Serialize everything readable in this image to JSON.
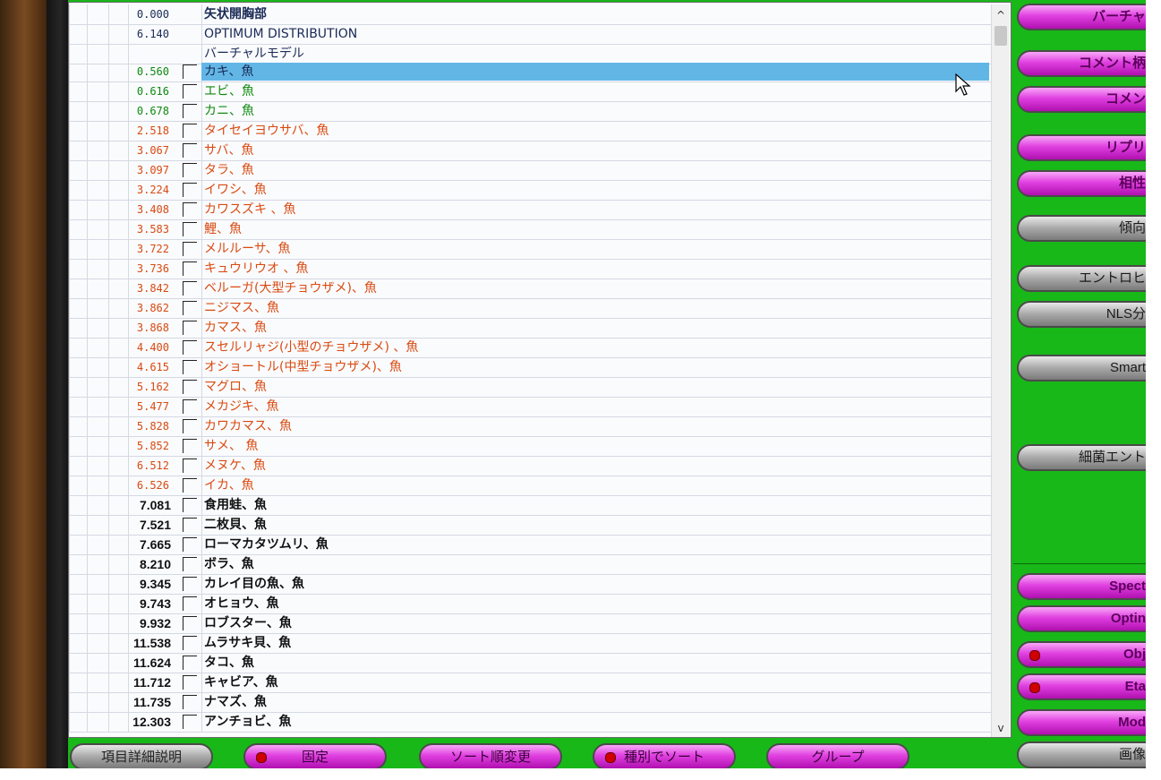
{
  "list": {
    "header_rows": [
      {
        "value": "0.000",
        "name": "矢状開胸部",
        "style": "navy-bold"
      },
      {
        "value": "6.140",
        "name": "OPTIMUM DISTRIBUTION",
        "style": "navy"
      },
      {
        "value": "",
        "name": "バーチャルモデル",
        "style": "navy"
      }
    ],
    "rows": [
      {
        "value": "0.560",
        "name": "カキ、魚",
        "color": "green",
        "selected": true
      },
      {
        "value": "0.616",
        "name": "エビ、魚",
        "color": "green"
      },
      {
        "value": "0.678",
        "name": "カニ、魚",
        "color": "green"
      },
      {
        "value": "2.518",
        "name": "タイセイヨウサバ、魚",
        "color": "orange"
      },
      {
        "value": "3.067",
        "name": "サバ、魚",
        "color": "orange"
      },
      {
        "value": "3.097",
        "name": "タラ、魚",
        "color": "orange"
      },
      {
        "value": "3.224",
        "name": "イワシ、魚",
        "color": "orange"
      },
      {
        "value": "3.408",
        "name": "カワスズキ 、魚",
        "color": "orange"
      },
      {
        "value": "3.583",
        "name": "鯉、魚",
        "color": "orange"
      },
      {
        "value": "3.722",
        "name": "メルルーサ、魚",
        "color": "orange"
      },
      {
        "value": "3.736",
        "name": "キュウリウオ 、魚",
        "color": "orange"
      },
      {
        "value": "3.842",
        "name": "ベルーガ(大型チョウザメ)、魚",
        "color": "orange"
      },
      {
        "value": "3.862",
        "name": "ニジマス、魚",
        "color": "orange"
      },
      {
        "value": "3.868",
        "name": "カマス、魚",
        "color": "orange"
      },
      {
        "value": "4.400",
        "name": "スセルリャジ(小型のチョウザメ) 、魚",
        "color": "orange"
      },
      {
        "value": "4.615",
        "name": "オショートル(中型チョウザメ)、魚",
        "color": "orange"
      },
      {
        "value": "5.162",
        "name": "マグロ、魚",
        "color": "orange"
      },
      {
        "value": "5.477",
        "name": "メカジキ、魚",
        "color": "orange"
      },
      {
        "value": "5.828",
        "name": "カワカマス、魚",
        "color": "orange"
      },
      {
        "value": "5.852",
        "name": "サメ、 魚",
        "color": "orange"
      },
      {
        "value": "6.512",
        "name": "メヌケ、魚",
        "color": "orange"
      },
      {
        "value": "6.526",
        "name": "イカ、魚",
        "color": "orange"
      },
      {
        "value": "7.081",
        "name": "食用蛙、魚",
        "color": "black"
      },
      {
        "value": "7.521",
        "name": "二枚貝、魚",
        "color": "black"
      },
      {
        "value": "7.665",
        "name": "ローマカタツムリ、魚",
        "color": "black"
      },
      {
        "value": "8.210",
        "name": "ボラ、魚",
        "color": "black"
      },
      {
        "value": "9.345",
        "name": "カレイ目の魚、魚",
        "color": "black"
      },
      {
        "value": "9.743",
        "name": "オヒョウ、魚",
        "color": "black"
      },
      {
        "value": "9.932",
        "name": "ロブスター、魚",
        "color": "black"
      },
      {
        "value": "11.538",
        "name": "ムラサキ貝、魚",
        "color": "black"
      },
      {
        "value": "11.624",
        "name": "タコ、魚",
        "color": "black"
      },
      {
        "value": "11.712",
        "name": "キャビア、魚",
        "color": "black"
      },
      {
        "value": "11.735",
        "name": "ナマズ、魚",
        "color": "black"
      },
      {
        "value": "12.303",
        "name": "アンチョビ、魚",
        "color": "black"
      }
    ]
  },
  "right_buttons": [
    {
      "label": "バーチャ",
      "style": "pink",
      "led": false
    },
    {
      "label": "コメント柄",
      "style": "pink",
      "led": false
    },
    {
      "label": "コメン",
      "style": "pink",
      "led": false
    },
    {
      "label": "リプリ",
      "style": "pink",
      "led": false
    },
    {
      "label": "相性",
      "style": "pink",
      "led": false
    },
    {
      "label": "傾向",
      "style": "gray",
      "led": false
    },
    {
      "label": "エントロヒ",
      "style": "gray",
      "led": false
    },
    {
      "label": "NLS分",
      "style": "gray",
      "led": false
    },
    {
      "label": "Smart",
      "style": "gray",
      "led": false
    },
    {
      "label": "細菌エント",
      "style": "gray",
      "led": false
    },
    {
      "label": "Spect",
      "style": "pink",
      "led": false
    },
    {
      "label": "Optin",
      "style": "pink",
      "led": false
    },
    {
      "label": "Obj",
      "style": "pink",
      "led": true
    },
    {
      "label": "Eta",
      "style": "pink",
      "led": true
    },
    {
      "label": "Mod",
      "style": "pink",
      "led": false
    },
    {
      "label": "画像",
      "style": "gray",
      "led": false
    }
  ],
  "bottom_buttons": [
    {
      "label": "項目詳細説明",
      "style": "gray",
      "led": false
    },
    {
      "label": "固定",
      "style": "pink",
      "led": true
    },
    {
      "label": "ソート順変更",
      "style": "pink",
      "led": false
    },
    {
      "label": "種別でソート",
      "style": "pink",
      "led": true
    },
    {
      "label": "グループ",
      "style": "pink",
      "led": false
    }
  ],
  "scrollbar": {
    "up_glyph": "^",
    "down_glyph": "v"
  },
  "colors": {
    "green_bg": "#18b818",
    "selection": "#62b6e6",
    "orange_text": "#d94a10",
    "green_text": "#0f8a10",
    "button_pink": "#e040e0"
  }
}
